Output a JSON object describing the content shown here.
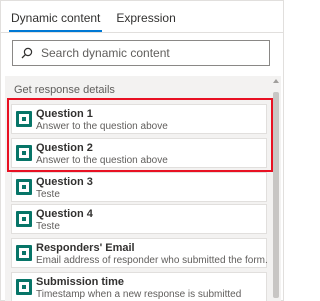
{
  "tabs": [
    {
      "label": "Dynamic content",
      "active": true
    },
    {
      "label": "Expression",
      "active": false
    }
  ],
  "search": {
    "placeholder": "Search dynamic content",
    "icon": "search-icon"
  },
  "section": {
    "label": "Get response details"
  },
  "items": [
    {
      "title": "Question 1",
      "desc": "Answer to the question above",
      "icon": "forms-icon",
      "highlighted": true
    },
    {
      "title": "Question 2",
      "desc": "Answer to the question above",
      "icon": "forms-icon",
      "highlighted": true
    },
    {
      "title": "Question 3",
      "desc": "Teste",
      "icon": "forms-icon",
      "highlighted": false
    },
    {
      "title": "Question 4",
      "desc": "Teste",
      "icon": "forms-icon",
      "highlighted": false
    },
    {
      "title": "Responders' Email",
      "desc": "Email address of responder who submitted the form.",
      "icon": "forms-icon",
      "highlighted": false
    },
    {
      "title": "Submission time",
      "desc": "Timestamp when a new response is submitted",
      "icon": "forms-icon",
      "highlighted": false
    }
  ],
  "colors": {
    "accent": "#0078d4",
    "highlight": "#e81123",
    "forms_icon": "#077568"
  }
}
